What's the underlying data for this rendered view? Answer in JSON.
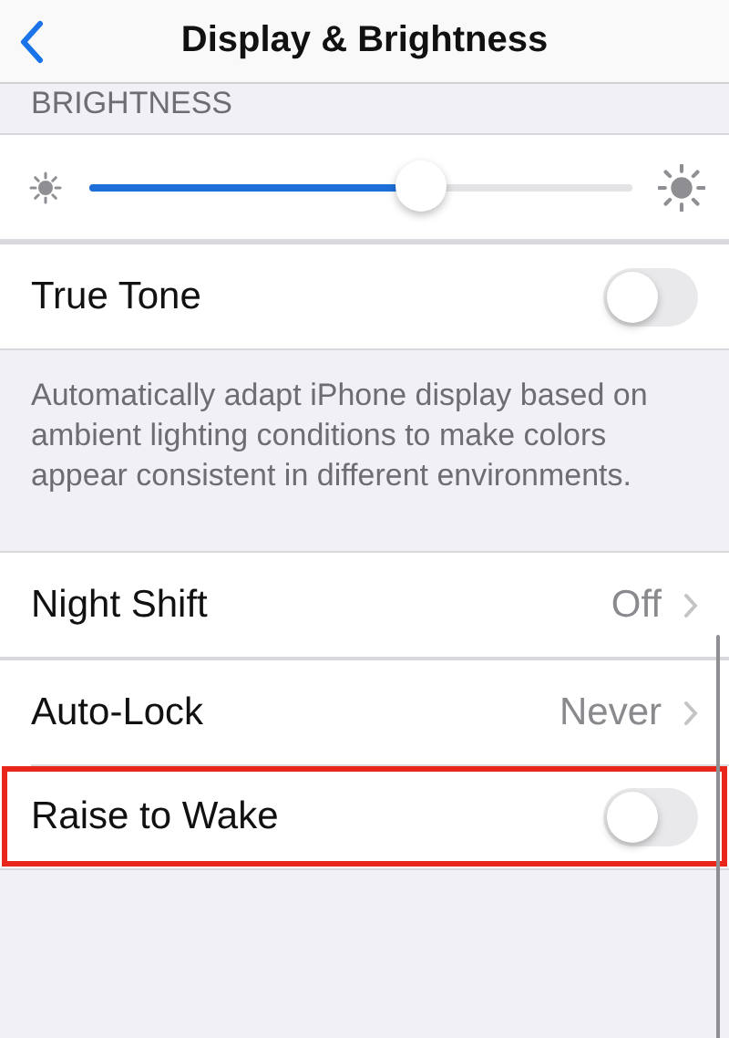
{
  "nav": {
    "title": "Display & Brightness"
  },
  "brightness": {
    "header": "BRIGHTNESS",
    "level": 0.61
  },
  "groups": [
    {
      "rows": [
        {
          "kind": "toggle",
          "label": "True Tone",
          "on": false,
          "highlighted": false
        }
      ],
      "footer": "Automatically adapt iPhone display based on ambient lighting conditions to make colors appear consistent in different environments."
    },
    {
      "rows": [
        {
          "kind": "link",
          "label": "Night Shift",
          "value": "Off",
          "highlighted": false
        }
      ]
    },
    {
      "rows": [
        {
          "kind": "link",
          "label": "Auto-Lock",
          "value": "Never",
          "highlighted": false
        },
        {
          "kind": "toggle",
          "label": "Raise to Wake",
          "on": false,
          "highlighted": true
        }
      ]
    }
  ]
}
